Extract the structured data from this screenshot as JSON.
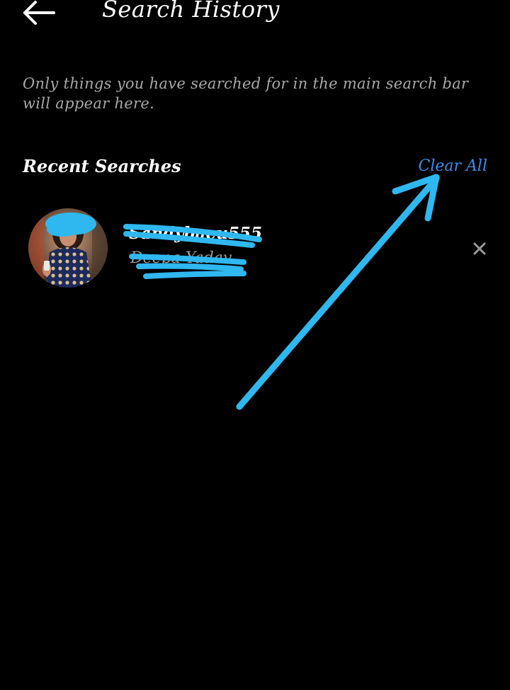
{
  "header": {
    "back_icon": "arrow-left-icon",
    "title": "Search History"
  },
  "info": {
    "text": "Only things you have searched for in the main search bar will appear here."
  },
  "recent": {
    "title": "Recent Searches",
    "clear_all_label": "Clear All",
    "items": [
      {
        "username": "Sandybaeu555",
        "subtitle": "Deepa Yadav",
        "remove_icon": "close-icon"
      }
    ]
  },
  "colors": {
    "background": "#000000",
    "link": "#3a8de8",
    "annotation": "#2fb8f0",
    "secondary_text": "#a8a8a8"
  }
}
